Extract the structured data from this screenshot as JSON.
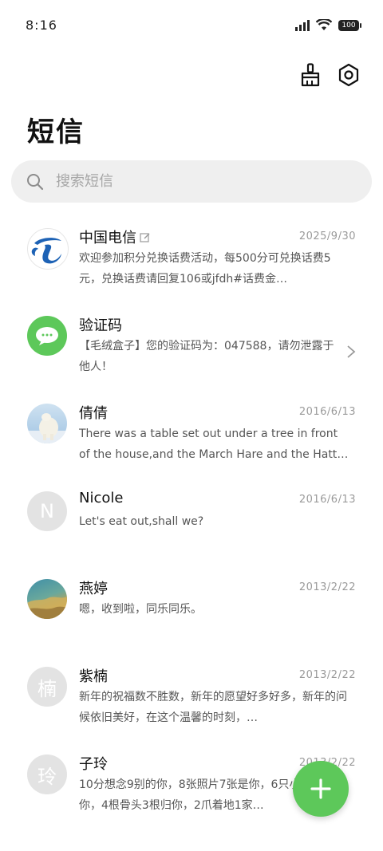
{
  "status_bar": {
    "time": "8:16",
    "battery": "100"
  },
  "header": {
    "title": "短信"
  },
  "search": {
    "placeholder": "搜索短信"
  },
  "conversations": [
    {
      "name": "中国电信",
      "date": "2025/9/30",
      "preview": "欢迎参加积分兑换话费活动，每500分可兑换话费5元，兑换话费请回复106或jfdh#话费金…",
      "avatar_icon": "china-telecom-logo",
      "draft_icon": "edit-icon"
    },
    {
      "name": "验证码",
      "date": "",
      "preview": "【毛绒盒子】您的验证码为：047588，请勿泄露于他人！",
      "avatar_icon": "message-bubble-icon",
      "accent": "#5dc85a"
    },
    {
      "name": "倩倩",
      "date": "2016/6/13",
      "preview": "There was a table set out under a tree in front of the house,and the March Hare and the Hatter wer…",
      "avatar_icon": "polar-bear-photo"
    },
    {
      "name": "Nicole",
      "date": "2016/6/13",
      "preview": "Let's eat out,shall we?",
      "avatar_initial": "N"
    },
    {
      "name": "燕婷",
      "date": "2013/2/22",
      "preview": "嗯，收到啦，同乐同乐。",
      "avatar_icon": "landscape-photo"
    },
    {
      "name": "紫楠",
      "date": "2013/2/22",
      "preview": "新年的祝福数不胜数，新年的愿望好多好多，新年的问候依旧美好，在这个温馨的时刻，…",
      "avatar_initial": "楠"
    },
    {
      "name": "子玲",
      "date": "2013/2/22",
      "preview": "10分想念9别的你，8张照片7张是你，6只小狗5只像你，4根骨头3根归你，2爪着地1家…",
      "avatar_initial": "玲"
    }
  ],
  "fab": {
    "icon": "plus-icon",
    "color": "#5dc85a"
  }
}
